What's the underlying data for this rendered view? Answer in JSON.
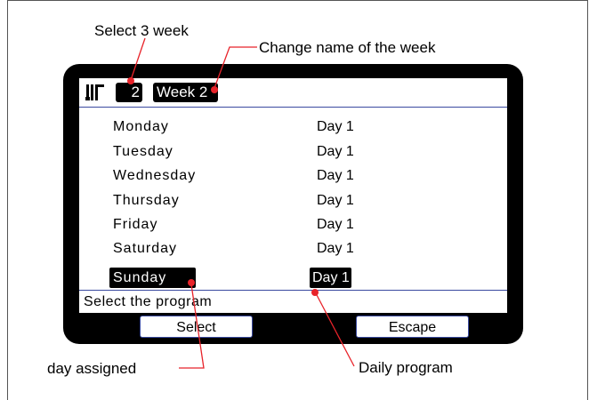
{
  "callouts": {
    "select_week": "Select 3 week",
    "change_name": "Change name of the week",
    "day_assigned": "day assigned",
    "daily_program": "Daily program"
  },
  "header": {
    "logo_icon": "thermostat-logo-icon",
    "week_number": "2",
    "week_name": "Week 2"
  },
  "rows": [
    {
      "day": "Monday",
      "program": "Day 1"
    },
    {
      "day": "Tuesday",
      "program": "Day 1"
    },
    {
      "day": "Wednesday",
      "program": "Day 1"
    },
    {
      "day": "Thursday",
      "program": "Day 1"
    },
    {
      "day": "Friday",
      "program": "Day 1"
    },
    {
      "day": "Saturday",
      "program": "Day 1"
    },
    {
      "day": "Sunday",
      "program": "Day 1",
      "selected": true
    }
  ],
  "status": "Select the program",
  "softkeys": {
    "left": "Select",
    "right": "Escape"
  },
  "colors": {
    "callout_line": "#e8232a",
    "divider": "#3a4aa0",
    "bezel": "#000000"
  }
}
